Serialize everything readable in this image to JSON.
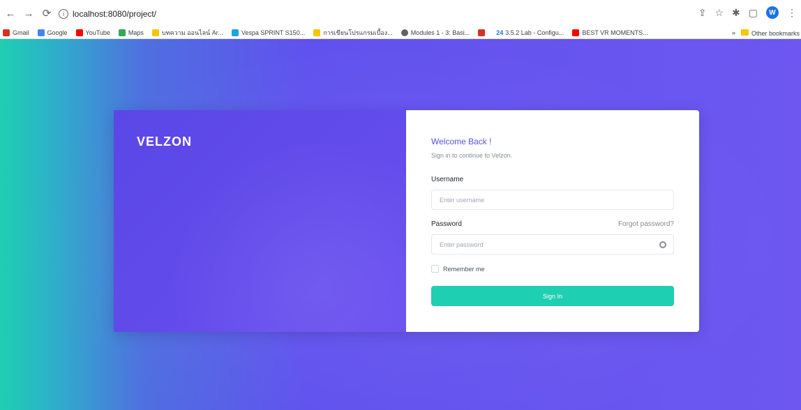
{
  "browser": {
    "url": "localhost:8080/project/",
    "profile_initial": "W",
    "bookmarks": [
      {
        "label": "Gmail",
        "color": "#d93025"
      },
      {
        "label": "Google",
        "color": "#4285f4"
      },
      {
        "label": "YouTube",
        "color": "#ff0000"
      },
      {
        "label": "Maps",
        "color": "#34a853"
      },
      {
        "label": "บทความ ออนไลน์ Ar...",
        "color": "#f9c400"
      },
      {
        "label": "Vespa SPRINT S150...",
        "color": "#1aa5e0"
      },
      {
        "label": "การเขียนโปรแกรมเบื้อง...",
        "color": "#f9c400"
      },
      {
        "label": "Modules 1 - 3: Basi...",
        "color": "#5f6368"
      },
      {
        "label": "24",
        "color": "#d93025"
      },
      {
        "label": "3.5.2 Lab - Configu...",
        "color": "#1a73e8"
      },
      {
        "label": "BEST VR MOMENTS...",
        "color": "#ff0000"
      }
    ],
    "more_label": "»",
    "other_bookmarks": "Other bookmarks"
  },
  "login": {
    "logo": "VELZON",
    "welcome": "Welcome Back !",
    "subtitle": "Sign in to continue to Velzon.",
    "username_label": "Username",
    "username_placeholder": "Enter username",
    "password_label": "Password",
    "forgot_password": "Forgot password?",
    "password_placeholder": "Enter password",
    "remember_me": "Remember me",
    "sign_in": "Sign In"
  },
  "colors": {
    "accent": "#1fcfb1",
    "brand": "#6052ee"
  }
}
